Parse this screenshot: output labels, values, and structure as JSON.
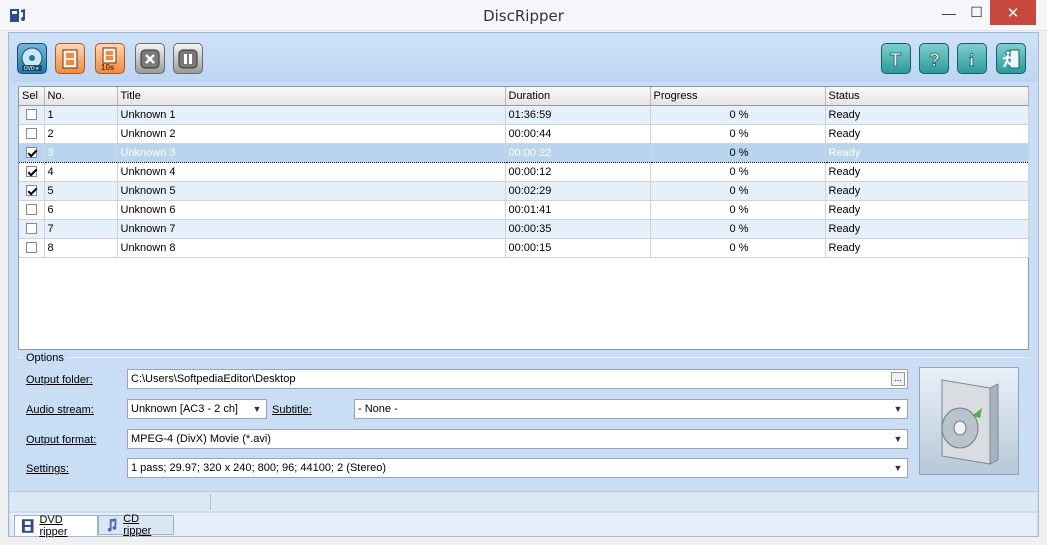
{
  "window": {
    "title": "DiscRipper",
    "minimize": "—",
    "maximize": "☐",
    "close": "✕"
  },
  "toolbar": {
    "left_buttons": [
      "dvd-source-icon",
      "rip-icon",
      "rip-10s-icon",
      "stop-icon",
      "pause-icon"
    ],
    "rip_10s_label": "10s",
    "right_buttons": [
      "tools-icon",
      "help-icon",
      "info-icon",
      "exit-icon"
    ],
    "tools_glyph": "T",
    "help_glyph": "?",
    "info_glyph": "i"
  },
  "table": {
    "columns": [
      "Sel",
      "No.",
      "Title",
      "Duration",
      "Progress",
      "Status"
    ],
    "rows": [
      {
        "sel": false,
        "no": "1",
        "title": "Unknown 1",
        "duration": "01:36:59",
        "progress": "0 %",
        "status": "Ready"
      },
      {
        "sel": false,
        "no": "2",
        "title": "Unknown 2",
        "duration": "00:00:44",
        "progress": "0 %",
        "status": "Ready"
      },
      {
        "sel": true,
        "no": "3",
        "title": "Unknown 3",
        "duration": "00:00:22",
        "progress": "0 %",
        "status": "Ready",
        "highlighted": true
      },
      {
        "sel": true,
        "no": "4",
        "title": "Unknown 4",
        "duration": "00:00:12",
        "progress": "0 %",
        "status": "Ready"
      },
      {
        "sel": true,
        "no": "5",
        "title": "Unknown 5",
        "duration": "00:02:29",
        "progress": "0 %",
        "status": "Ready"
      },
      {
        "sel": false,
        "no": "6",
        "title": "Unknown 6",
        "duration": "00:01:41",
        "progress": "0 %",
        "status": "Ready"
      },
      {
        "sel": false,
        "no": "7",
        "title": "Unknown 7",
        "duration": "00:00:35",
        "progress": "0 %",
        "status": "Ready"
      },
      {
        "sel": false,
        "no": "8",
        "title": "Unknown 8",
        "duration": "00:00:15",
        "progress": "0 %",
        "status": "Ready"
      }
    ]
  },
  "options": {
    "legend": "Options",
    "output_folder_label": "Output folder:",
    "output_folder_value": "C:\\Users\\SoftpediaEditor\\Desktop",
    "browse_label": "...",
    "audio_stream_label": "Audio stream:",
    "audio_stream_value": "Unknown [AC3 - 2 ch]",
    "subtitle_label": "Subtitle:",
    "subtitle_value": "- None -",
    "output_format_label": "Output format:",
    "output_format_value": "MPEG-4 (DivX) Movie (*.avi)",
    "settings_label": "Settings:",
    "settings_value": "1 pass; 29.97; 320 x 240; 800; 96; 44100; 2 (Stereo)",
    "dropdown_arrow": "▼"
  },
  "tabs": {
    "dvd_ripper": "DVD ripper",
    "cd_ripper": "CD ripper"
  },
  "colors": {
    "frame": "#c9ddf4",
    "selected_row": "#b9d4ee",
    "alt_row": "#e6f0fa",
    "close_button": "#c7473c"
  }
}
